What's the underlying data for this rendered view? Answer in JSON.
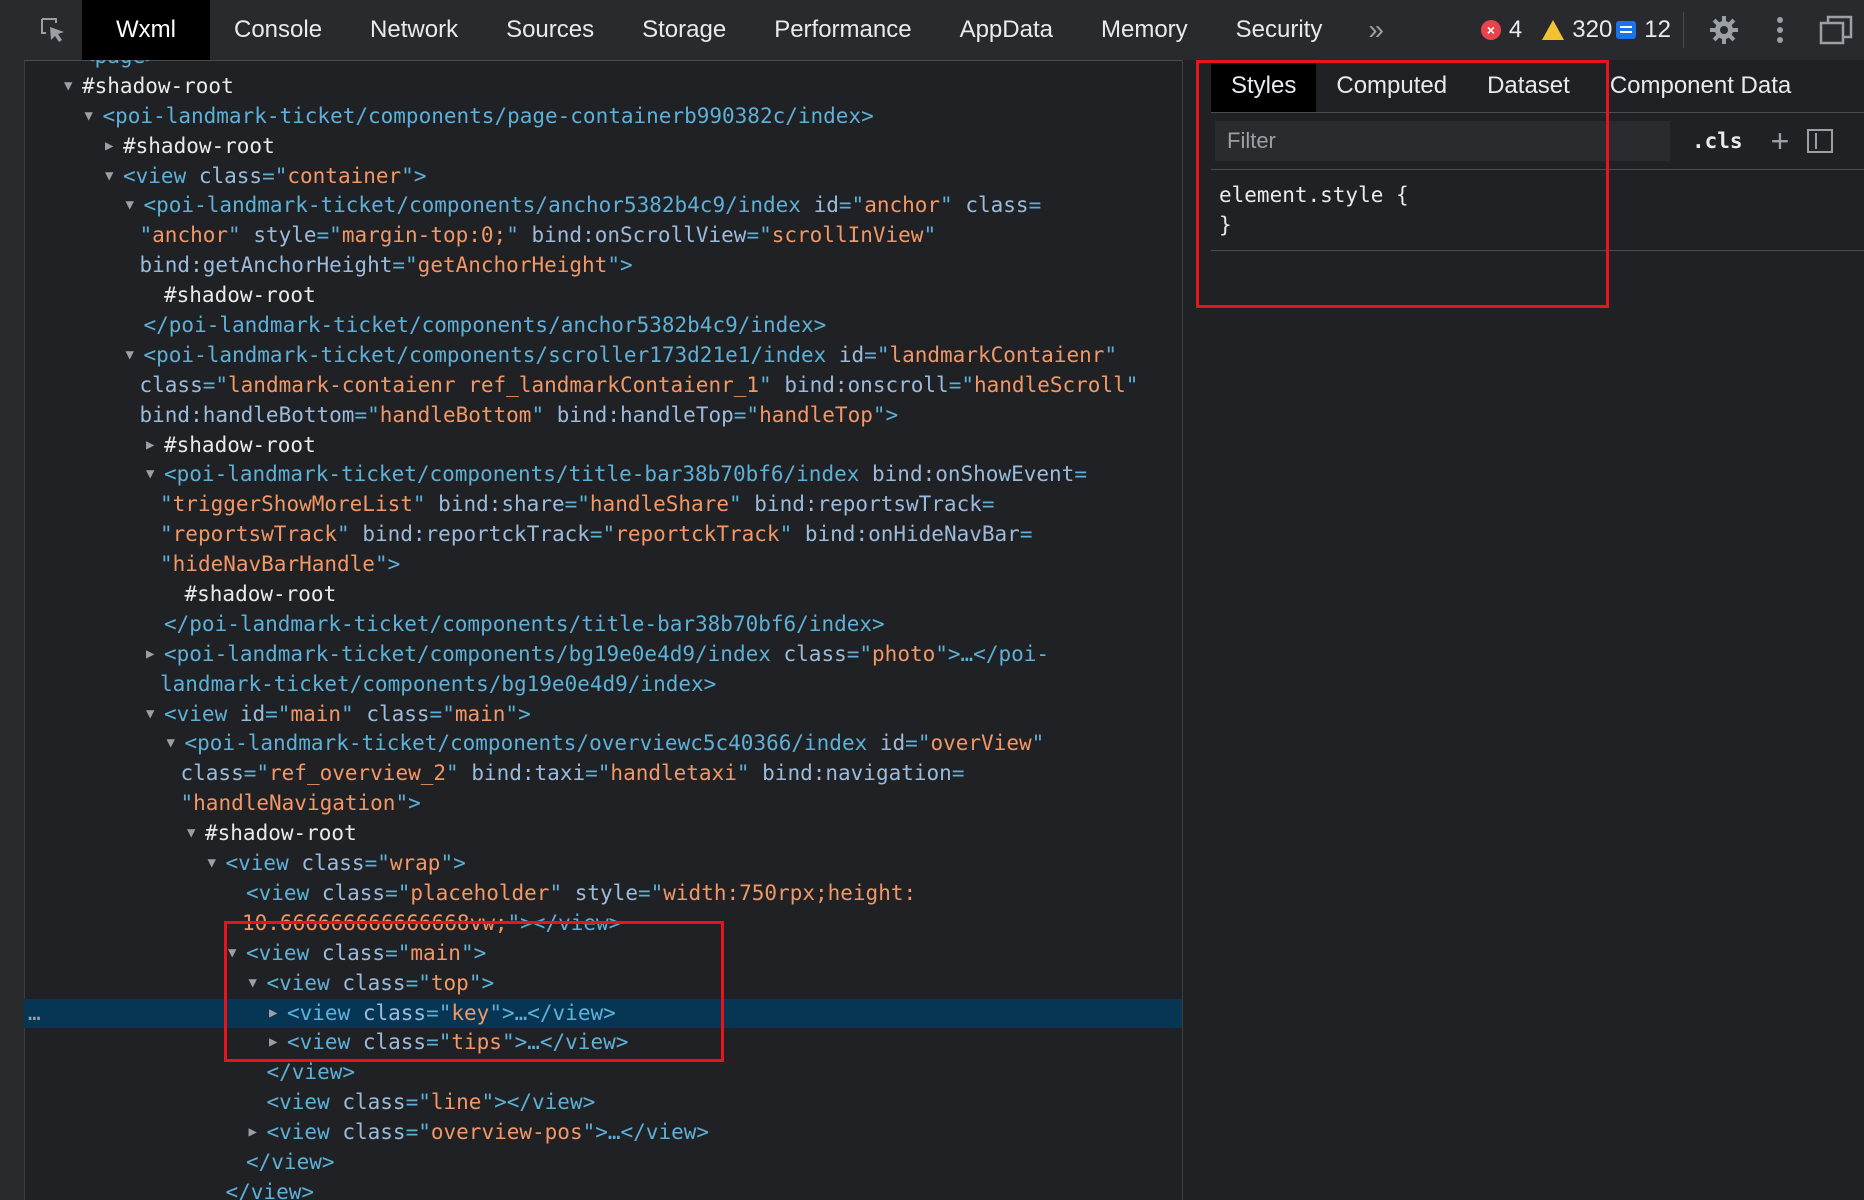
{
  "toolbar": {
    "tabs": [
      "Wxml",
      "Console",
      "Network",
      "Sources",
      "Storage",
      "Performance",
      "AppData",
      "Memory",
      "Security"
    ],
    "more": "»",
    "errors": "4",
    "warnings": "320",
    "messages": "12"
  },
  "styles_pane": {
    "tabs": [
      "Styles",
      "Computed",
      "Dataset",
      "Component Data"
    ],
    "filter_placeholder": "Filter",
    "cls": ".cls",
    "rule_open": "element.style {",
    "rule_close": "}"
  },
  "tree": [
    {
      "indent": 1,
      "arrow": "",
      "parts": [
        [
          "tg",
          "<page>"
        ]
      ]
    },
    {
      "indent": 1,
      "arrow": "down",
      "parts": [
        [
          "sr",
          "#shadow-root"
        ]
      ]
    },
    {
      "indent": 2,
      "arrow": "down",
      "parts": [
        [
          "tg",
          "<poi-landmark-ticket/components/page-containerb990382c/index>"
        ]
      ]
    },
    {
      "indent": 3,
      "arrow": "right",
      "parts": [
        [
          "sr",
          "#shadow-root"
        ]
      ]
    },
    {
      "indent": 3,
      "arrow": "down",
      "parts": [
        [
          "tg",
          "<view "
        ],
        [
          "an",
          "class"
        ],
        [
          "tg",
          "=\""
        ],
        [
          "av",
          "container"
        ],
        [
          "tg",
          "\">"
        ]
      ]
    },
    {
      "indent": 4,
      "arrow": "down",
      "parts": [
        [
          "tg",
          "<poi-landmark-ticket/components/anchor5382b4c9/index "
        ],
        [
          "an",
          "id"
        ],
        [
          "tg",
          "=\""
        ],
        [
          "av",
          "anchor"
        ],
        [
          "tg",
          "\" "
        ],
        [
          "an",
          "class"
        ],
        [
          "tg",
          "="
        ]
      ]
    },
    {
      "indent": 4,
      "cont": true,
      "parts": [
        [
          "tg",
          "\""
        ],
        [
          "av",
          "anchor"
        ],
        [
          "tg",
          "\" "
        ],
        [
          "an",
          "style"
        ],
        [
          "tg",
          "=\""
        ],
        [
          "av",
          "margin-top:0;"
        ],
        [
          "tg",
          "\" "
        ],
        [
          "an",
          "bind:onScrollView"
        ],
        [
          "tg",
          "=\""
        ],
        [
          "av",
          "scrollInView"
        ],
        [
          "tg",
          "\""
        ]
      ]
    },
    {
      "indent": 4,
      "cont": true,
      "parts": [
        [
          "an",
          "bind:getAnchorHeight"
        ],
        [
          "tg",
          "=\""
        ],
        [
          "av",
          "getAnchorHeight"
        ],
        [
          "tg",
          "\">"
        ]
      ]
    },
    {
      "indent": 5,
      "arrow": "",
      "parts": [
        [
          "sr",
          "#shadow-root"
        ]
      ]
    },
    {
      "indent": 4,
      "arrow": "",
      "parts": [
        [
          "tg",
          "</poi-landmark-ticket/components/anchor5382b4c9/index>"
        ]
      ]
    },
    {
      "indent": 4,
      "arrow": "down",
      "parts": [
        [
          "tg",
          "<poi-landmark-ticket/components/scroller173d21e1/index "
        ],
        [
          "an",
          "id"
        ],
        [
          "tg",
          "=\""
        ],
        [
          "av",
          "landmarkContaienr"
        ],
        [
          "tg",
          "\""
        ]
      ]
    },
    {
      "indent": 4,
      "cont": true,
      "parts": [
        [
          "an",
          "class"
        ],
        [
          "tg",
          "=\""
        ],
        [
          "av",
          "landmark-contaienr ref_landmarkContaienr_1"
        ],
        [
          "tg",
          "\" "
        ],
        [
          "an",
          "bind:onscroll"
        ],
        [
          "tg",
          "=\""
        ],
        [
          "av",
          "handleScroll"
        ],
        [
          "tg",
          "\""
        ]
      ]
    },
    {
      "indent": 4,
      "cont": true,
      "parts": [
        [
          "an",
          "bind:handleBottom"
        ],
        [
          "tg",
          "=\""
        ],
        [
          "av",
          "handleBottom"
        ],
        [
          "tg",
          "\" "
        ],
        [
          "an",
          "bind:handleTop"
        ],
        [
          "tg",
          "=\""
        ],
        [
          "av",
          "handleTop"
        ],
        [
          "tg",
          "\">"
        ]
      ]
    },
    {
      "indent": 5,
      "arrow": "right",
      "parts": [
        [
          "sr",
          "#shadow-root"
        ]
      ]
    },
    {
      "indent": 5,
      "arrow": "down",
      "parts": [
        [
          "tg",
          "<poi-landmark-ticket/components/title-bar38b70bf6/index "
        ],
        [
          "an",
          "bind:onShowEvent"
        ],
        [
          "tg",
          "="
        ]
      ]
    },
    {
      "indent": 5,
      "cont": true,
      "parts": [
        [
          "tg",
          "\""
        ],
        [
          "av",
          "triggerShowMoreList"
        ],
        [
          "tg",
          "\" "
        ],
        [
          "an",
          "bind:share"
        ],
        [
          "tg",
          "=\""
        ],
        [
          "av",
          "handleShare"
        ],
        [
          "tg",
          "\" "
        ],
        [
          "an",
          "bind:reportswTrack"
        ],
        [
          "tg",
          "="
        ]
      ]
    },
    {
      "indent": 5,
      "cont": true,
      "parts": [
        [
          "tg",
          "\""
        ],
        [
          "av",
          "reportswTrack"
        ],
        [
          "tg",
          "\" "
        ],
        [
          "an",
          "bind:reportckTrack"
        ],
        [
          "tg",
          "=\""
        ],
        [
          "av",
          "reportckTrack"
        ],
        [
          "tg",
          "\" "
        ],
        [
          "an",
          "bind:onHideNavBar"
        ],
        [
          "tg",
          "="
        ]
      ]
    },
    {
      "indent": 5,
      "cont": true,
      "parts": [
        [
          "tg",
          "\""
        ],
        [
          "av",
          "hideNavBarHandle"
        ],
        [
          "tg",
          "\">"
        ]
      ]
    },
    {
      "indent": 6,
      "arrow": "",
      "parts": [
        [
          "sr",
          "#shadow-root"
        ]
      ]
    },
    {
      "indent": 5,
      "arrow": "",
      "parts": [
        [
          "tg",
          "</poi-landmark-ticket/components/title-bar38b70bf6/index>"
        ]
      ]
    },
    {
      "indent": 5,
      "arrow": "right",
      "parts": [
        [
          "tg",
          "<poi-landmark-ticket/components/bg19e0e4d9/index "
        ],
        [
          "an",
          "class"
        ],
        [
          "tg",
          "=\""
        ],
        [
          "av",
          "photo"
        ],
        [
          "tg",
          "\">…</poi-"
        ]
      ]
    },
    {
      "indent": 5,
      "cont": true,
      "parts": [
        [
          "tg",
          "landmark-ticket/components/bg19e0e4d9/index>"
        ]
      ]
    },
    {
      "indent": 5,
      "arrow": "down",
      "parts": [
        [
          "tg",
          "<view "
        ],
        [
          "an",
          "id"
        ],
        [
          "tg",
          "=\""
        ],
        [
          "av",
          "main"
        ],
        [
          "tg",
          "\" "
        ],
        [
          "an",
          "class"
        ],
        [
          "tg",
          "=\""
        ],
        [
          "av",
          "main"
        ],
        [
          "tg",
          "\">"
        ]
      ]
    },
    {
      "indent": 6,
      "arrow": "down",
      "parts": [
        [
          "tg",
          "<poi-landmark-ticket/components/overviewc5c40366/index "
        ],
        [
          "an",
          "id"
        ],
        [
          "tg",
          "=\""
        ],
        [
          "av",
          "overView"
        ],
        [
          "tg",
          "\""
        ]
      ]
    },
    {
      "indent": 6,
      "cont": true,
      "parts": [
        [
          "an",
          "class"
        ],
        [
          "tg",
          "=\""
        ],
        [
          "av",
          "ref_overview_2"
        ],
        [
          "tg",
          "\" "
        ],
        [
          "an",
          "bind:taxi"
        ],
        [
          "tg",
          "=\""
        ],
        [
          "av",
          "handletaxi"
        ],
        [
          "tg",
          "\" "
        ],
        [
          "an",
          "bind:navigation"
        ],
        [
          "tg",
          "="
        ]
      ]
    },
    {
      "indent": 6,
      "cont": true,
      "parts": [
        [
          "tg",
          "\""
        ],
        [
          "av",
          "handleNavigation"
        ],
        [
          "tg",
          "\">"
        ]
      ]
    },
    {
      "indent": 7,
      "arrow": "down",
      "parts": [
        [
          "sr",
          "#shadow-root"
        ]
      ]
    },
    {
      "indent": 8,
      "arrow": "down",
      "parts": [
        [
          "tg",
          "<view "
        ],
        [
          "an",
          "class"
        ],
        [
          "tg",
          "=\""
        ],
        [
          "av",
          "wrap"
        ],
        [
          "tg",
          "\">"
        ]
      ]
    },
    {
      "indent": 9,
      "arrow": "",
      "parts": [
        [
          "tg",
          "<view "
        ],
        [
          "an",
          "class"
        ],
        [
          "tg",
          "=\""
        ],
        [
          "av",
          "placeholder"
        ],
        [
          "tg",
          "\" "
        ],
        [
          "an",
          "style"
        ],
        [
          "tg",
          "=\""
        ],
        [
          "av",
          "width:750rpx;height:"
        ]
      ]
    },
    {
      "indent": 9,
      "cont": true,
      "parts": [
        [
          "av",
          "10.666666666666668vw;"
        ],
        [
          "tg",
          "\"></view>"
        ]
      ]
    },
    {
      "indent": 9,
      "arrow": "down",
      "parts": [
        [
          "tg",
          "<view "
        ],
        [
          "an",
          "class"
        ],
        [
          "tg",
          "=\""
        ],
        [
          "av",
          "main"
        ],
        [
          "tg",
          "\">"
        ]
      ]
    },
    {
      "indent": 10,
      "arrow": "down",
      "parts": [
        [
          "tg",
          "<view "
        ],
        [
          "an",
          "class"
        ],
        [
          "tg",
          "=\""
        ],
        [
          "av",
          "top"
        ],
        [
          "tg",
          "\">"
        ]
      ]
    },
    {
      "indent": 11,
      "arrow": "right",
      "selected": true,
      "parts": [
        [
          "tg",
          "<view "
        ],
        [
          "an",
          "class"
        ],
        [
          "tg",
          "=\""
        ],
        [
          "av",
          "key"
        ],
        [
          "tg",
          "\">…</view>"
        ]
      ]
    },
    {
      "indent": 11,
      "arrow": "right",
      "parts": [
        [
          "tg",
          "<view "
        ],
        [
          "an",
          "class"
        ],
        [
          "tg",
          "=\""
        ],
        [
          "av",
          "tips"
        ],
        [
          "tg",
          "\">…</view>"
        ]
      ]
    },
    {
      "indent": 10,
      "arrow": "",
      "parts": [
        [
          "tg",
          "</view>"
        ]
      ]
    },
    {
      "indent": 10,
      "arrow": "",
      "parts": [
        [
          "tg",
          "<view "
        ],
        [
          "an",
          "class"
        ],
        [
          "tg",
          "=\""
        ],
        [
          "av",
          "line"
        ],
        [
          "tg",
          "\"></view>"
        ]
      ]
    },
    {
      "indent": 10,
      "arrow": "right",
      "parts": [
        [
          "tg",
          "<view "
        ],
        [
          "an",
          "class"
        ],
        [
          "tg",
          "=\""
        ],
        [
          "av",
          "overview-pos"
        ],
        [
          "tg",
          "\">…</view>"
        ]
      ]
    },
    {
      "indent": 9,
      "arrow": "",
      "parts": [
        [
          "tg",
          "</view>"
        ]
      ]
    },
    {
      "indent": 8,
      "arrow": "",
      "parts": [
        [
          "tg",
          "</view>"
        ]
      ]
    }
  ],
  "selected_marker": "…"
}
